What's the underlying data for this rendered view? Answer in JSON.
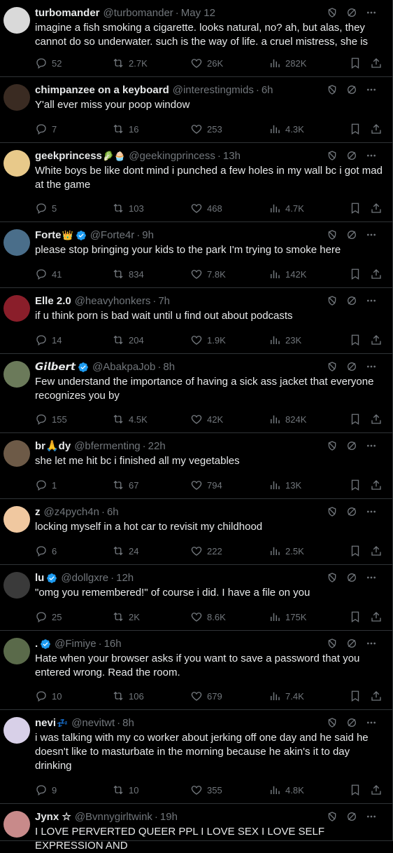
{
  "colors": {
    "background": "#000000",
    "text": "#e7e9ea",
    "muted": "#71767b",
    "border": "#2f3336",
    "verified": "#1d9bf0"
  },
  "tweets": [
    {
      "name": "turbomander",
      "handle": "@turbomander",
      "time": "May 12",
      "verified": false,
      "emoji": "",
      "text": "imagine a fish smoking a cigarette. looks natural, no? ah, but alas, they cannot do so underwater. such is the way of life. a cruel mistress, she is",
      "replies": "52",
      "retweets": "2.7K",
      "likes": "26K",
      "views": "282K",
      "avatar_color": "#d9d9d9",
      "height": 110
    },
    {
      "name": "chimpanzee on a keyboard",
      "handle": "@interestingmids",
      "time": "6h",
      "verified": false,
      "emoji": "",
      "text": "Y'all ever miss your poop window",
      "replies": "7",
      "retweets": "16",
      "likes": "253",
      "views": "4.3K",
      "avatar_color": "#3a2b22",
      "height": 94
    },
    {
      "name": "geekprincess",
      "handle": "@geekingprincess",
      "time": "13h",
      "verified": false,
      "emoji": "🥬🧁",
      "text": "White boys be like dont mind i punched a few holes in my wall bc i got mad at the game",
      "replies": "5",
      "retweets": "103",
      "likes": "468",
      "views": "4.7K",
      "avatar_color": "#e8c98a",
      "height": 113
    },
    {
      "name": "Forte",
      "handle": "@Forte4r",
      "time": "9h",
      "verified": true,
      "emoji": "👑",
      "text": "please stop bringing your kids to the park I'm trying to smoke here",
      "replies": "41",
      "retweets": "834",
      "likes": "7.8K",
      "views": "142K",
      "avatar_color": "#4a6e8a",
      "height": 94
    },
    {
      "name": "Elle 2.0",
      "handle": "@heavyhonkers",
      "time": "7h",
      "verified": false,
      "emoji": "",
      "text": "if u think porn is bad wait until u find out about podcasts",
      "replies": "14",
      "retweets": "204",
      "likes": "1.9K",
      "views": "23K",
      "avatar_color": "#8a1e2a",
      "height": 94
    },
    {
      "name": "𝙂𝙞𝙡𝙗𝙚𝙧𝙩",
      "handle": "@AbakpaJob",
      "time": "8h",
      "verified": true,
      "emoji": "",
      "text": "Few understand the importance of having a sick ass jacket that everyone recognizes you by",
      "replies": "155",
      "retweets": "4.5K",
      "likes": "42K",
      "views": "824K",
      "avatar_color": "#6b7a5a",
      "height": 113
    },
    {
      "name": "br🙏dy",
      "handle": "@bfermenting",
      "time": "22h",
      "verified": false,
      "emoji": "",
      "text": "she let me hit bc i finished all my vegetables",
      "replies": "1",
      "retweets": "67",
      "likes": "794",
      "views": "13K",
      "avatar_color": "#6d5a47",
      "height": 94
    },
    {
      "name": "z",
      "handle": "@z4pych4n",
      "time": "6h",
      "verified": false,
      "emoji": "",
      "text": "locking myself in a hot car to revisit my childhood",
      "replies": "6",
      "retweets": "24",
      "likes": "222",
      "views": "2.5K",
      "avatar_color": "#f0c8a0",
      "height": 94
    },
    {
      "name": "lu",
      "handle": "@dollgxre",
      "time": "12h",
      "verified": true,
      "emoji": "",
      "text": "\"omg you remembered!\" of course i did. I have a file on you",
      "replies": "25",
      "retweets": "2K",
      "likes": "8.6K",
      "views": "175K",
      "avatar_color": "#3a3a3a",
      "height": 94
    },
    {
      "name": ".",
      "handle": "@Fimiye",
      "time": "16h",
      "verified": true,
      "emoji": "",
      "text": "Hate when your browser asks if you want to save a password that you entered wrong. Read the room.",
      "replies": "10",
      "retweets": "106",
      "likes": "679",
      "views": "7.4K",
      "avatar_color": "#5a6a4a",
      "height": 113
    },
    {
      "name": "nevi",
      "handle": "@nevitwt",
      "time": "8h",
      "verified": false,
      "emoji": "💤",
      "text": "i was talking with my co worker about jerking off one day and he said he doesn't like to masturbate in the morning because he akin's it to day drinking",
      "replies": "9",
      "retweets": "10",
      "likes": "355",
      "views": "4.8K",
      "avatar_color": "#d8d0e8",
      "height": 134
    },
    {
      "name": "Jynx ☆",
      "handle": "@Bvnnygirltwink",
      "time": "19h",
      "verified": false,
      "emoji": "",
      "text": "I LOVE PERVERTED QUEER PPL I LOVE SEX I LOVE SELF EXPRESSION AND",
      "replies": "",
      "retweets": "",
      "likes": "",
      "views": "",
      "avatar_color": "#c88a8a",
      "height": 53
    }
  ]
}
